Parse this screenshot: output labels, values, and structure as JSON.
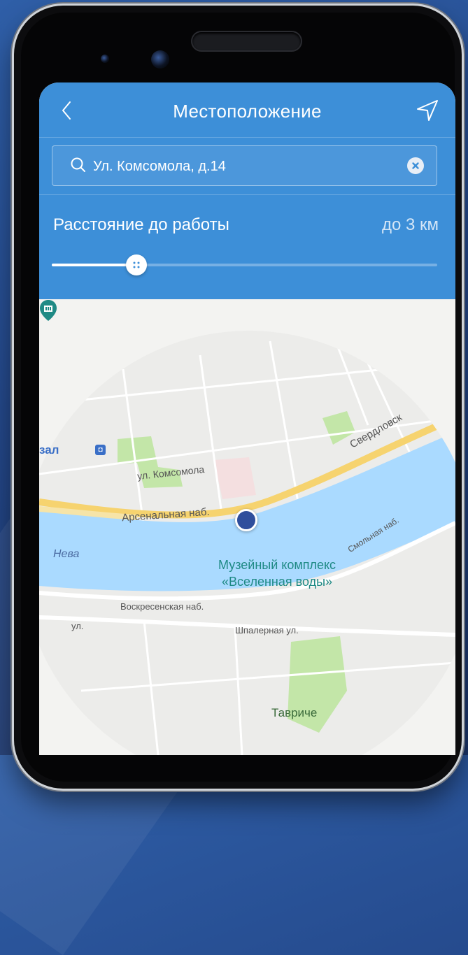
{
  "header": {
    "title": "Местоположение"
  },
  "search": {
    "value": "Ул. Комсомола, д.14"
  },
  "distance": {
    "label": "Расстояние до работы",
    "value": "до 3 км",
    "slider_fraction": 0.22
  },
  "map": {
    "streets": {
      "komsomola": "ул. Комсомола",
      "arsenalnaya": "Арсенальная наб.",
      "sverdlovskaya": "Свердловск",
      "smolnaya": "Смольная наб.",
      "voskresenskaya": "Воскресенская наб.",
      "shpalernaya": "Шпалерная ул.",
      "ul": "ул."
    },
    "river": "Нева",
    "station": "зал",
    "poi": {
      "line1": "Музейный комплекс",
      "line2": "«Вселенная воды»"
    },
    "park": "Тавриче"
  },
  "colors": {
    "header_bg": "#3d8fd8",
    "water": "#aadaff",
    "road_major": "#f6d36f",
    "park": "#c3e6a8",
    "location_dot": "#2f4e9c",
    "poi": "#1f8a85"
  },
  "icons": {
    "back": "chevron-left-icon",
    "location": "navigation-arrow-icon",
    "search": "search-icon",
    "clear": "clear-circle-icon",
    "slider_thumb": "grip-dots-icon"
  }
}
